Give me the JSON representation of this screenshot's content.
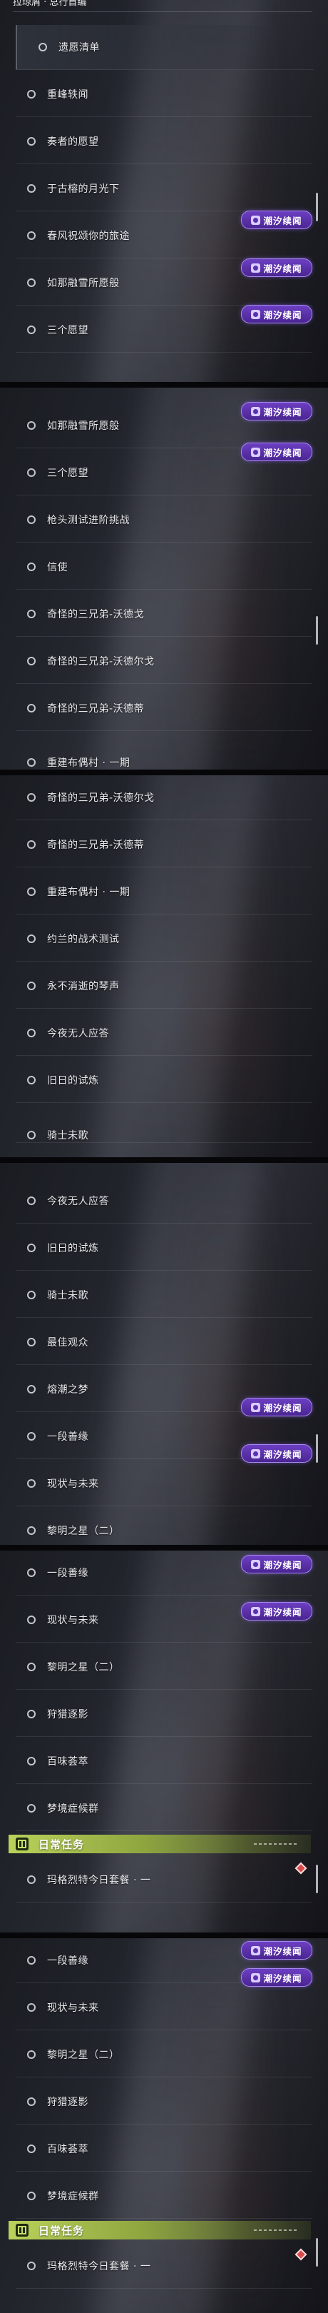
{
  "badge_label": "潮汐续闻",
  "header_label": "日常任务",
  "top_partial": "拉琼屑 · 总行首编",
  "colors": {
    "badge": "#5a2fb0",
    "header": "#b9d25a",
    "diamond": "#d84b4b"
  },
  "panels": [
    {
      "rows": [
        "遗愿清单",
        "重峰轶闻",
        "奏者的愿望",
        "于古榕的月光下",
        "春风祝颂你的旅途",
        "如那融雪所愿般",
        "三个愿望"
      ]
    },
    {
      "rows": [
        "如那融雪所愿般",
        "三个愿望",
        "枪头测试进阶挑战",
        "信使",
        "奇怪的三兄弟-沃德戈",
        "奇怪的三兄弟-沃德尔戈",
        "奇怪的三兄弟-沃德蒂",
        "重建布偶村 · 一期"
      ]
    },
    {
      "rows": [
        "奇怪的三兄弟-沃德尔戈",
        "奇怪的三兄弟-沃德蒂",
        "重建布偶村 · 一期",
        "约兰的战术测试",
        "永不消逝的琴声",
        "今夜无人应答",
        "旧日的试炼",
        "骑士未歌"
      ]
    },
    {
      "rows": [
        "今夜无人应答",
        "旧日的试炼",
        "骑士未歌",
        "最佳观众",
        "熔潮之梦",
        "一段善缘",
        "现状与未来",
        "黎明之星（二）"
      ]
    },
    {
      "rows": [
        "一段善缘",
        "现状与未来",
        "黎明之星（二）",
        "狩猎逐影",
        "百味荟萃",
        "梦境症候群",
        "玛格烈特今日套餐 · 一"
      ]
    },
    {
      "rows": [
        "一段善缘",
        "现状与未来",
        "黎明之星（二）",
        "狩猎逐影",
        "百味荟萃",
        "梦境症候群",
        "玛格烈特今日套餐 · 一"
      ]
    }
  ]
}
